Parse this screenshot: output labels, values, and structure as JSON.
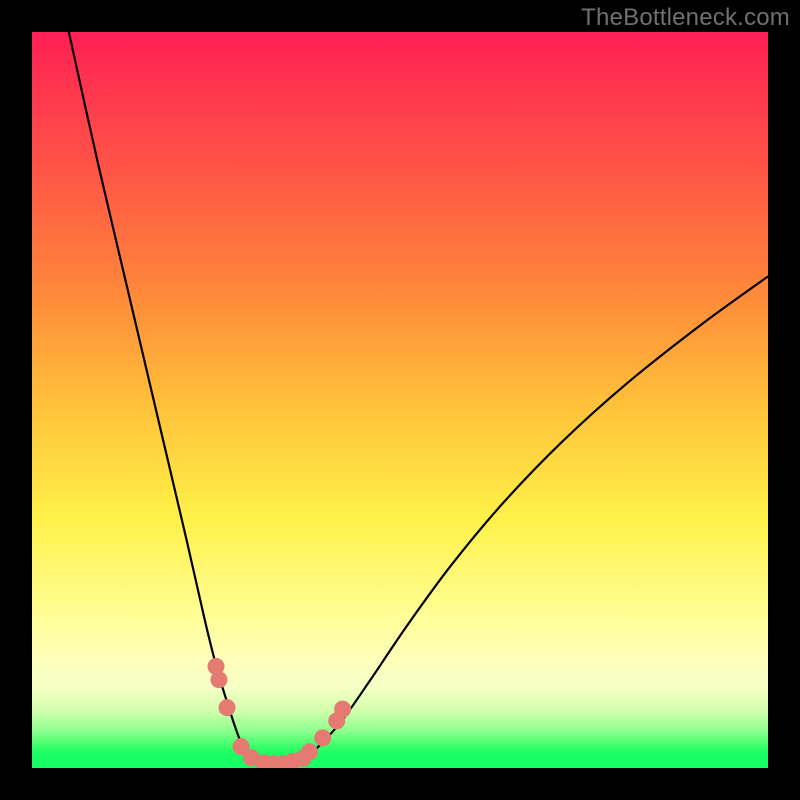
{
  "watermark": "TheBottleneck.com",
  "colors": {
    "frame": "#000000",
    "dot": "#e47a72",
    "curve": "#000000",
    "gradient": [
      "#ff1f54",
      "#ff5e44",
      "#ffbf3a",
      "#fff148",
      "#feffb8",
      "#8dff8e",
      "#16ff63"
    ]
  },
  "chart_data": {
    "type": "line",
    "title": "",
    "xlabel": "",
    "ylabel": "",
    "xrange": [
      0,
      100
    ],
    "yrange": [
      0,
      100
    ],
    "series": [
      {
        "name": "curve",
        "x": [
          5,
          9,
          13,
          17,
          21,
          23.5,
          25,
          26.8,
          28.5,
          29.8,
          31,
          33,
          35,
          37,
          39,
          42,
          46,
          51,
          57,
          64,
          72,
          81,
          91,
          100
        ],
        "y": [
          100,
          82,
          65,
          48,
          31,
          20,
          14,
          8,
          3.2,
          1.5,
          0.7,
          0.5,
          0.6,
          1.2,
          3,
          6.3,
          12,
          19.4,
          27.6,
          36,
          44.3,
          52.4,
          60.3,
          66.8
        ]
      }
    ],
    "markers": [
      {
        "x": 25.0,
        "y": 13.8
      },
      {
        "x": 25.4,
        "y": 12.0
      },
      {
        "x": 26.5,
        "y": 8.2
      },
      {
        "x": 28.4,
        "y": 2.9
      },
      {
        "x": 29.8,
        "y": 1.4
      },
      {
        "x": 31.5,
        "y": 0.7
      },
      {
        "x": 32.8,
        "y": 0.6
      },
      {
        "x": 34.1,
        "y": 0.6
      },
      {
        "x": 35.4,
        "y": 0.9
      },
      {
        "x": 36.8,
        "y": 1.3
      },
      {
        "x": 37.7,
        "y": 2.2
      },
      {
        "x": 39.5,
        "y": 4.1
      },
      {
        "x": 41.4,
        "y": 6.4
      },
      {
        "x": 42.2,
        "y": 8.0
      }
    ]
  }
}
